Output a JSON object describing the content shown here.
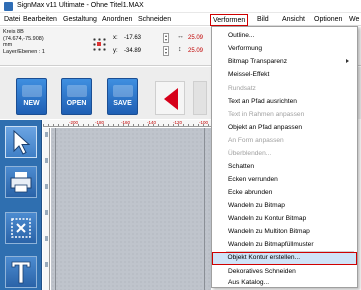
{
  "window": {
    "title": "SignMax v11 Ultimate - Ohne Titel1.MAX"
  },
  "menubar": [
    {
      "label": "Datei"
    },
    {
      "label": "Bearbeiten"
    },
    {
      "label": "Gestaltung"
    },
    {
      "label": "Anordnen"
    },
    {
      "label": "Schneiden"
    },
    {
      "label": "Verformen",
      "open": true
    },
    {
      "label": "Bild"
    },
    {
      "label": "Ansicht"
    },
    {
      "label": "Optionen"
    },
    {
      "label": "We"
    }
  ],
  "propbar": {
    "info_line1": "Kreis 8B",
    "info_line2": "(74.674,-75.908)",
    "info_line3": "mm",
    "info_line4": "Layer/Ebenen : 1",
    "x_label": "x:",
    "x_value": "-17.63",
    "y_label": "y:",
    "y_value": "-34.89",
    "w_value": "25.09",
    "h_value": "25.09"
  },
  "toolbar": {
    "new_label": "NEW",
    "open_label": "OPEN",
    "save_label": "SAVE"
  },
  "ruler": {
    "ticks": [
      "-200",
      "-180",
      "-160",
      "-140",
      "-120",
      "-100"
    ]
  },
  "verformen_menu": {
    "items": [
      {
        "label": "Outline...",
        "enabled": true
      },
      {
        "label": "Verformung",
        "enabled": true
      },
      {
        "label": "Bitmap Transparenz",
        "enabled": true,
        "submenu": true
      },
      {
        "label": "Meissel-Effekt",
        "enabled": true
      },
      {
        "label": "Rundsatz",
        "enabled": false
      },
      {
        "label": "Text an Pfad ausrichten",
        "enabled": true
      },
      {
        "label": "Text in Rahmen anpassen",
        "enabled": false
      },
      {
        "label": "Objekt an Pfad anpassen",
        "enabled": true
      },
      {
        "label": "An Form anpassen",
        "enabled": false
      },
      {
        "label": "Überblenden...",
        "enabled": false
      },
      {
        "label": "Schatten",
        "enabled": true
      },
      {
        "label": "Ecken verrunden",
        "enabled": true
      },
      {
        "label": "Ecke abrunden",
        "enabled": true
      },
      {
        "label": "Wandeln zu Bitmap",
        "enabled": true
      },
      {
        "label": "Wandeln zu Kontur Bitmap",
        "enabled": true
      },
      {
        "label": "Wandeln zu Multiton Bitmap",
        "enabled": true
      },
      {
        "label": "Wandeln zu Bitmapfüllmuster",
        "enabled": true
      },
      {
        "label": "Objekt Kontur erstellen...",
        "enabled": true,
        "highlighted": true
      },
      {
        "label": "Dekoratives Schneiden",
        "enabled": true
      },
      {
        "label": "Aus Katalog...",
        "enabled": true
      }
    ]
  },
  "colors": {
    "accent_red": "#d00000",
    "toolbar_blue": "#2a63a8",
    "highlight_bg": "#cfe3f7"
  }
}
